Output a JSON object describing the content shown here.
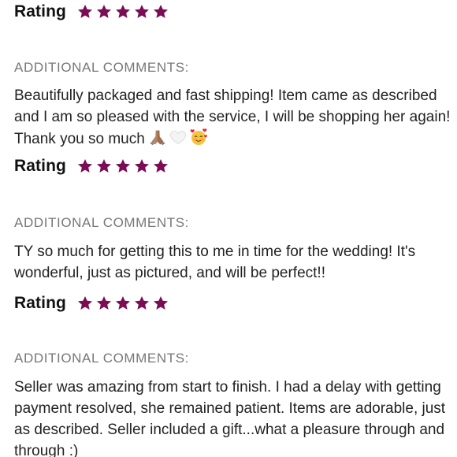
{
  "accent_color": "#7a0d54",
  "reviews": [
    {
      "rating_label": "Rating",
      "stars": 5
    },
    {
      "section_label": "ADDITIONAL COMMENTS:",
      "comment": "Beautifully packaged and fast shipping! Item came as described and I am so pleased with the service, I will be shopping her again! Thank you so much",
      "emojis": [
        "folded-hands-icon",
        "white-heart-icon",
        "smiling-face-with-hearts-icon"
      ],
      "rating_label": "Rating",
      "stars": 5
    },
    {
      "section_label": "ADDITIONAL COMMENTS:",
      "comment": "TY so much for getting this to me in time for the wedding! It's wonderful, just as pictured, and will be perfect!!",
      "rating_label": "Rating",
      "stars": 5
    },
    {
      "section_label": "ADDITIONAL COMMENTS:",
      "comment": "Seller was amazing from start to finish. I had a delay with getting payment resolved, she remained patient. Items are adorable, just as described. Seller included a gift...what a pleasure through and through :)"
    }
  ]
}
